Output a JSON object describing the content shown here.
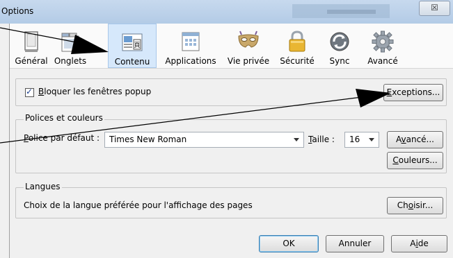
{
  "window": {
    "title": "Options",
    "close_glyph": "☒"
  },
  "toolbar": {
    "items": [
      {
        "label": "Général",
        "icon": "general-icon"
      },
      {
        "label": "Onglets",
        "icon": "tabs-icon"
      },
      {
        "label": "Contenu",
        "icon": "content-icon",
        "selected": true
      },
      {
        "label": "Applications",
        "icon": "applications-icon"
      },
      {
        "label": "Vie privée",
        "icon": "privacy-mask-icon"
      },
      {
        "label": "Sécurité",
        "icon": "padlock-icon"
      },
      {
        "label": "Sync",
        "icon": "sync-icon"
      },
      {
        "label": "Avancé",
        "icon": "gear-icon"
      }
    ]
  },
  "popup": {
    "checkbox_label_u": "B",
    "checkbox_label_rest": "loquer les fenêtres popup",
    "checked": true,
    "exceptions_u": "E",
    "exceptions_rest": "xceptions..."
  },
  "fonts": {
    "legend": "Polices et couleurs",
    "default_font_label_u": "P",
    "default_font_label_rest": "olice par défaut :",
    "default_font_value": "Times New Roman",
    "size_label_u": "T",
    "size_label_rest": "aille :",
    "size_value": "16",
    "advanced_pre": "A",
    "advanced_u": "v",
    "advanced_rest": "ancé...",
    "colors_u": "C",
    "colors_rest": "ouleurs..."
  },
  "languages": {
    "legend": "Langues",
    "description": "Choix de la langue préférée pour l'affichage des pages",
    "choose_pre": "Ch",
    "choose_u": "o",
    "choose_rest": "isir..."
  },
  "footer": {
    "ok": "OK",
    "cancel": "Annuler",
    "help_pre": "A",
    "help_u": "i",
    "help_rest": "de"
  },
  "colors": {
    "accent_selected": "#d6e8fb",
    "titlebar": "#b3cbe6",
    "arrow": "#000000"
  }
}
